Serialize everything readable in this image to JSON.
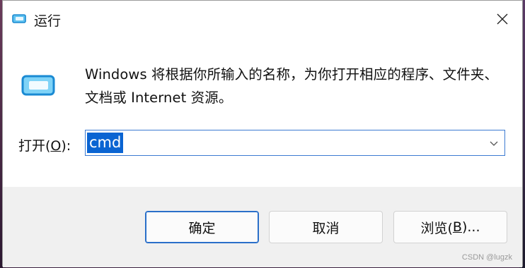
{
  "window": {
    "title": "运行",
    "close_icon": "close-icon"
  },
  "description": "Windows 将根据你所输入的名称，为你打开相应的程序、文件夹、文档或 Internet 资源。",
  "open_field": {
    "label_prefix": "打开(",
    "label_mnemonic": "O",
    "label_suffix": "):",
    "value": "cmd"
  },
  "buttons": {
    "ok": "确定",
    "cancel": "取消",
    "browse_prefix": "浏览(",
    "browse_mnemonic": "B",
    "browse_suffix": ")..."
  },
  "watermark": "CSDN @lugzk",
  "colors": {
    "accent": "#0a64d2",
    "icon_blue": "#2d9ad9"
  }
}
